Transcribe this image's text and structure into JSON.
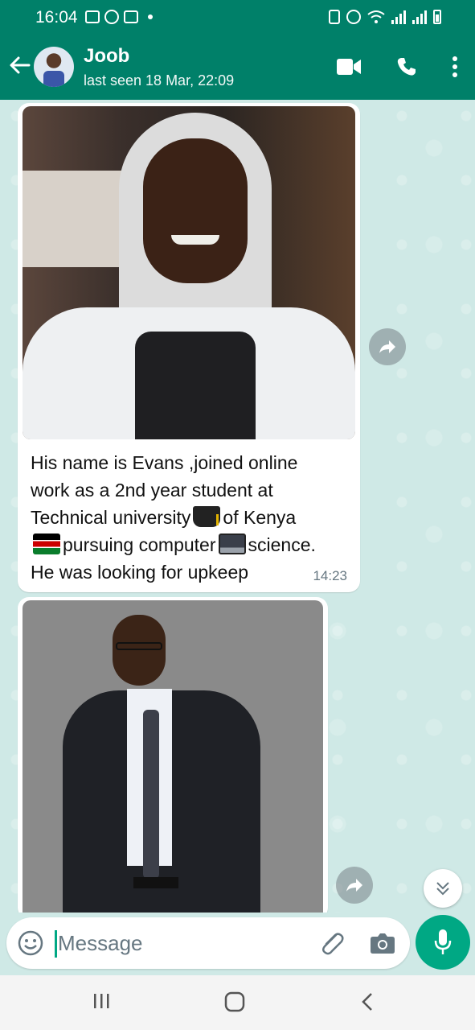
{
  "status_bar": {
    "time": "16:04"
  },
  "header": {
    "contact_name": "Joob",
    "last_seen": "last seen 18 Mar, 22:09"
  },
  "messages": [
    {
      "type": "image_with_caption",
      "caption_lines": [
        [
          "His name is Evans ,joined online"
        ],
        [
          "work as a 2nd year student at"
        ],
        [
          "Technical university",
          "graduation-cap-emoji",
          "of Kenya"
        ],
        [
          "kenya-flag-emoji",
          "pursuing computer",
          "desktop-computer-emoji",
          "science."
        ],
        [
          "He was looking for upkeep"
        ]
      ],
      "line1": "His name is Evans ,joined online",
      "line2": "work as a 2nd year student at",
      "line3a": "Technical university",
      "line3b": "of Kenya",
      "line4a": "pursuing computer",
      "line4b": "science.",
      "line5": "He was looking for upkeep",
      "time": "14:23"
    },
    {
      "type": "image"
    }
  ],
  "composer": {
    "placeholder": "Message"
  },
  "colors": {
    "header": "#008069",
    "accent": "#00a884",
    "chat_bg": "#cfe9e6"
  }
}
